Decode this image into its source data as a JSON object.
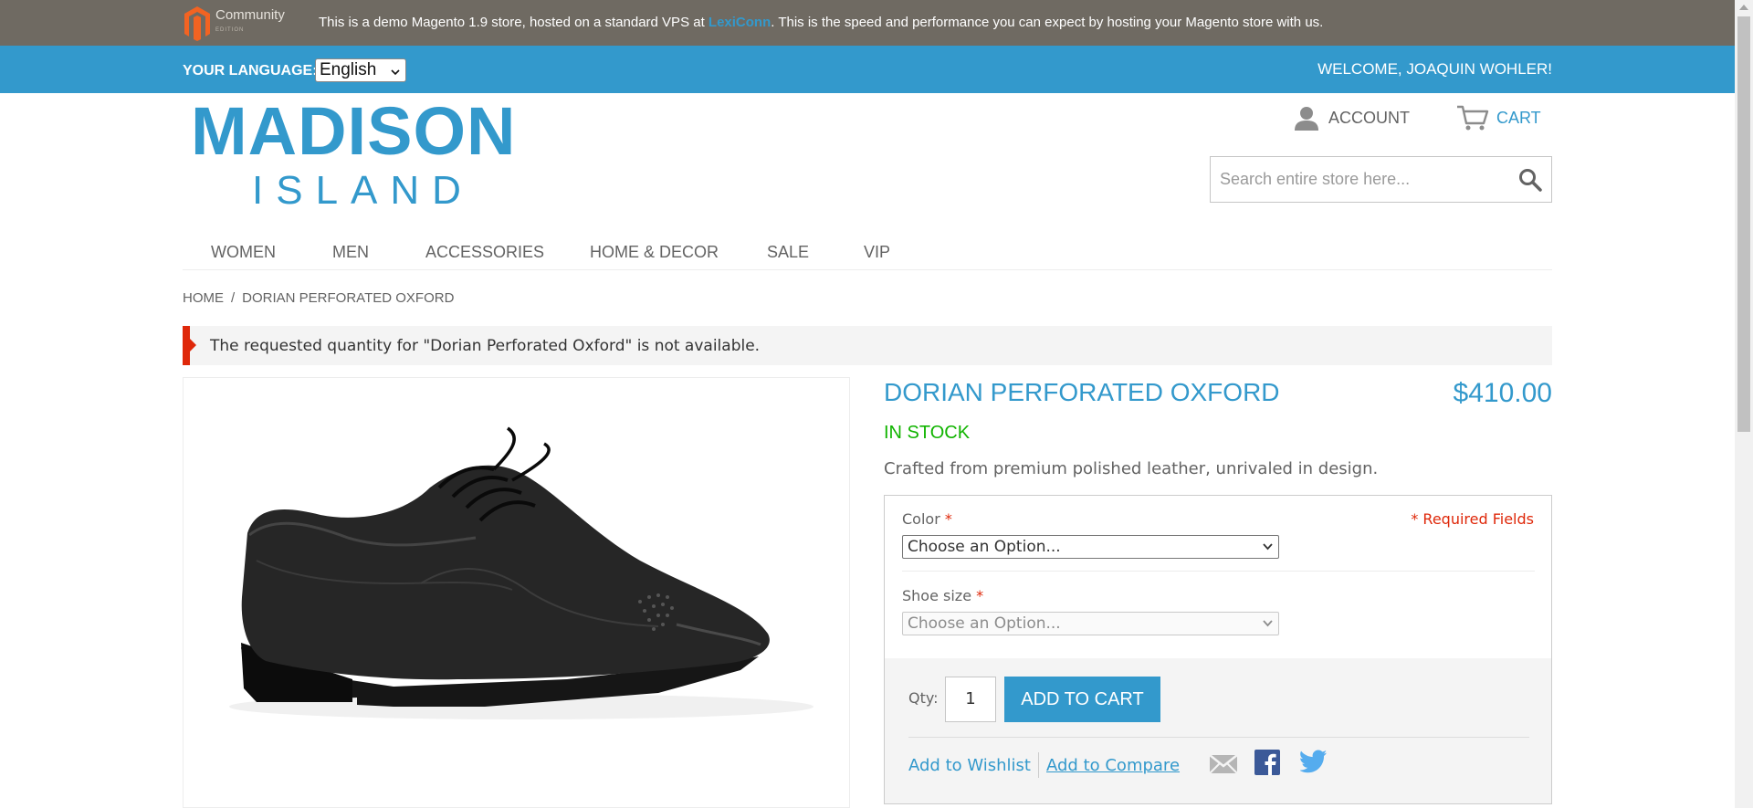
{
  "demo_bar": {
    "logo_text": "Community",
    "logo_subtext": "EDITION",
    "notice_before": "This is a demo Magento 1.9 store, hosted on a standard VPS at ",
    "notice_link": "LexiConn",
    "notice_after": ". This is the speed and performance you can expect by hosting your Magento store with us."
  },
  "header": {
    "language_label": "YOUR LANGUAGE:",
    "language_value": "English",
    "welcome": "WELCOME, JOAQUIN WOHLER!",
    "logo_main": "MADISON",
    "logo_sub": "ISLAND",
    "account_label": "ACCOUNT",
    "cart_label": "CART",
    "search_placeholder": "Search entire store here..."
  },
  "nav": {
    "items": [
      "WOMEN",
      "MEN",
      "ACCESSORIES",
      "HOME & DECOR",
      "SALE",
      "VIP"
    ]
  },
  "breadcrumb": {
    "home": "HOME",
    "separator": "/",
    "current": "DORIAN PERFORATED OXFORD"
  },
  "message": {
    "error": "The requested quantity for \"Dorian Perforated Oxford\" is not available."
  },
  "product": {
    "name": "DORIAN PERFORATED OXFORD",
    "price": "$410.00",
    "stock": "IN STOCK",
    "description": "Crafted from premium polished leather, unrivaled in design.",
    "required_note": "* Required Fields",
    "color_label": "Color",
    "color_value": "Choose an Option...",
    "size_label": "Shoe size",
    "size_value": "Choose an Option...",
    "required_mark": "*",
    "qty_label": "Qty:",
    "qty_value": "1",
    "add_to_cart": "ADD TO CART",
    "wishlist": "Add to Wishlist",
    "compare": "Add to Compare"
  },
  "colors": {
    "brand_blue": "#3399cc",
    "demo_bar": "#6f6a62",
    "in_stock": "#11b400",
    "error": "#df280a"
  },
  "icons": {
    "magento": "magento-logo-icon",
    "account": "user-icon",
    "cart": "cart-icon",
    "search": "search-icon",
    "email": "email-icon",
    "facebook": "facebook-icon",
    "twitter": "twitter-icon"
  }
}
